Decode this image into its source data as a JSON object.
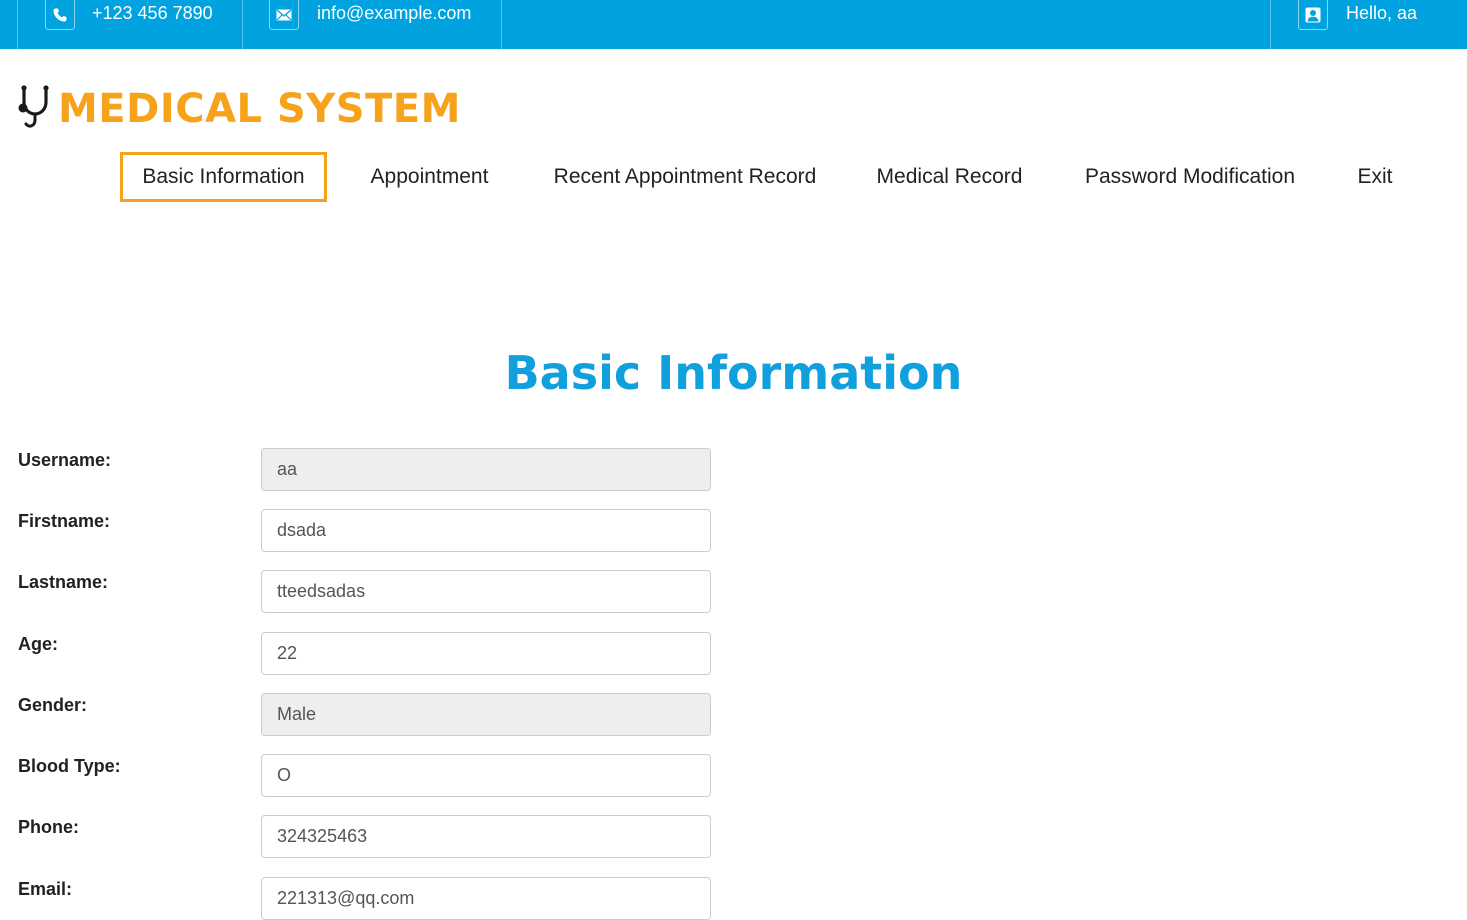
{
  "topbar": {
    "phone": "+123 456 7890",
    "email": "info@example.com",
    "greeting": "Hello, aa",
    "phone_icon": "phone-icon",
    "email_icon": "envelope-icon",
    "user_icon": "user-icon"
  },
  "brand": {
    "name": "MEDICAL SYSTEM",
    "logo_icon": "stethoscope-icon",
    "accent_color": "#f7a21b",
    "primary_color": "#00a3e0"
  },
  "nav": {
    "items": [
      {
        "label": "Basic Information",
        "active": true
      },
      {
        "label": "Appointment"
      },
      {
        "label": "Recent Appointment Record"
      },
      {
        "label": "Medical Record"
      },
      {
        "label": "Password Modification"
      },
      {
        "label": "Exit"
      }
    ]
  },
  "page": {
    "title": "Basic Information"
  },
  "form": {
    "fields": [
      {
        "label": "Username:",
        "value": "aa",
        "readonly": true
      },
      {
        "label": "Firstname:",
        "value": "dsada"
      },
      {
        "label": "Lastname:",
        "value": "tteedsadas"
      },
      {
        "label": "Age:",
        "value": "22"
      },
      {
        "label": "Gender:",
        "value": "Male",
        "readonly": true
      },
      {
        "label": "Blood Type:",
        "value": "O"
      },
      {
        "label": "Phone:",
        "value": "324325463"
      },
      {
        "label": "Email:",
        "value": "221313@qq.com"
      }
    ]
  }
}
